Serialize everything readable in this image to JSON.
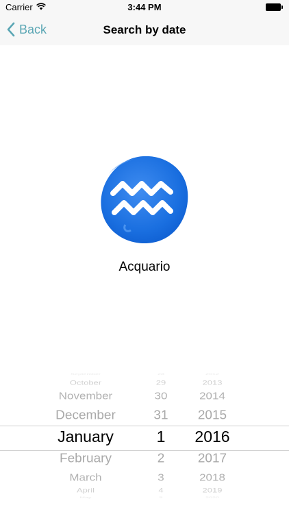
{
  "status_bar": {
    "carrier": "Carrier",
    "time": "3:44 PM"
  },
  "nav": {
    "back_label": "Back",
    "title": "Search by date"
  },
  "sign": {
    "name": "Acquario",
    "icon": "aquarius-icon",
    "color": "#1a6fe0"
  },
  "picker": {
    "month": {
      "items": [
        "September",
        "October",
        "November",
        "December",
        "January",
        "February",
        "March",
        "April",
        "May"
      ],
      "selected": "January"
    },
    "day": {
      "items": [
        "28",
        "29",
        "30",
        "31",
        "1",
        "2",
        "3",
        "4",
        "5"
      ],
      "selected": "1"
    },
    "year": {
      "items": [
        "2012",
        "2013",
        "2014",
        "2015",
        "2016",
        "2017",
        "2018",
        "2019",
        "2020"
      ],
      "selected": "2016"
    }
  }
}
